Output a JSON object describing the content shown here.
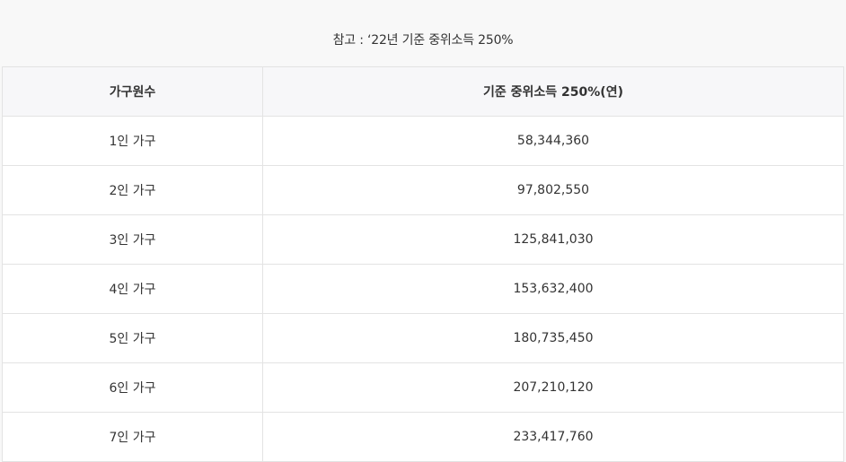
{
  "caption": "참고 : ‘22년 기준 중위소득 250%",
  "table": {
    "headers": [
      "가구원수",
      "기준 중위소득 250%(연)"
    ],
    "rows": [
      [
        "1인 가구",
        "58,344,360"
      ],
      [
        "2인 가구",
        "97,802,550"
      ],
      [
        "3인 가구",
        "125,841,030"
      ],
      [
        "4인 가구",
        "153,632,400"
      ],
      [
        "5인 가구",
        "180,735,450"
      ],
      [
        "6인 가구",
        "207,210,120"
      ],
      [
        "7인 가구",
        "233,417,760"
      ]
    ]
  },
  "colors": {
    "border": "#e3e3e3",
    "header_bg": "#f7f7f9",
    "page_bg": "#f8f8f8",
    "text": "#333333"
  }
}
